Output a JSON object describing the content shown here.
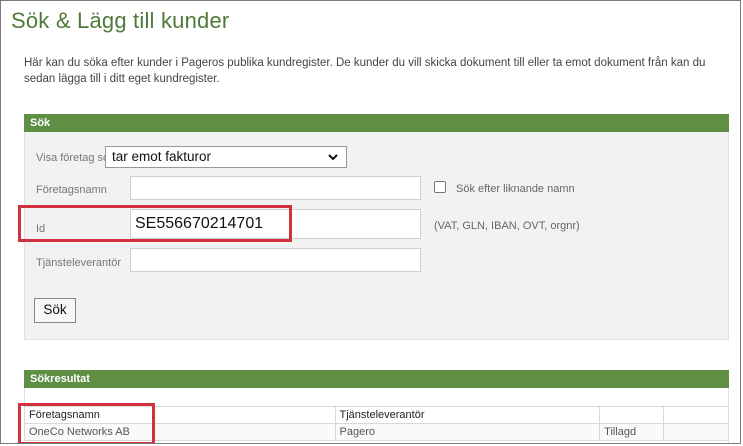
{
  "page": {
    "title": "Sök & Lägg till kunder",
    "intro": "Här kan du söka efter kunder i Pageros publika kundregister. De kunder du vill skicka dokument till eller ta emot dokument från kan du sedan lägga till i ditt eget kundregister."
  },
  "search": {
    "header": "Sök",
    "show_companies_label": "Visa företag som",
    "show_companies_value": "tar emot fakturor",
    "company_name_label": "Företagsnamn",
    "company_name_value": "",
    "similar_names_label": "Sök efter liknande namn",
    "similar_names_checked": false,
    "id_label": "Id",
    "id_value": "SE556670214701",
    "id_hint": "(VAT, GLN, IBAN, OVT, orgnr)",
    "provider_label": "Tjänsteleverantör",
    "provider_value": "",
    "search_button": "Sök"
  },
  "results": {
    "header": "Sökresultat",
    "columns": [
      "Företagsnamn",
      "Tjänsteleverantör",
      "",
      ""
    ],
    "rows": [
      {
        "company": "OneCo Networks AB",
        "provider": "Pagero",
        "status": "Tillagd",
        "extra": ""
      }
    ]
  },
  "colors": {
    "title_green": "#4f7a3a",
    "bar_green": "#5e8f45",
    "highlight_red": "#d0313c"
  },
  "icons": {
    "dropdown": "chevron-down-icon"
  }
}
